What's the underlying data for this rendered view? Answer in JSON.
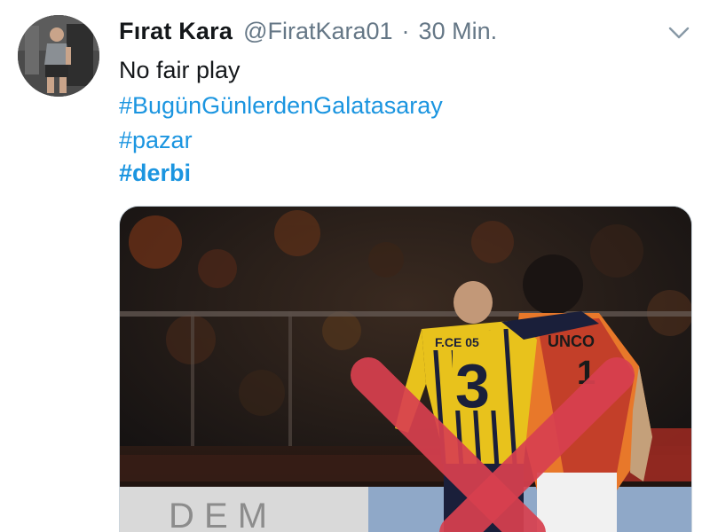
{
  "tweet": {
    "display_name": "Fırat Kara",
    "handle": "@FiratKara01",
    "separator": "·",
    "time": "30 Min.",
    "lines": [
      "No fair play",
      "#BugünGünlerdenGalatasaray",
      "#pazar",
      "#derbi"
    ],
    "icons": {
      "more": "chevron-down-icon",
      "avatar": "avatar"
    }
  },
  "media": {
    "jersey_left_text": "F.CE  05",
    "jersey_left_number": "3",
    "jersey_right_text": "UNCO",
    "jersey_right_number": "1",
    "banner_text": "D E M",
    "overlay_color": "#d8404f",
    "colors": {
      "link": "#1b95e0",
      "muted": "#657786",
      "fenerbahce_yellow": "#e8c21c",
      "fenerbahce_navy": "#1a1f3a",
      "galatasaray_orange": "#e8782a",
      "galatasaray_red": "#b3262a"
    }
  }
}
